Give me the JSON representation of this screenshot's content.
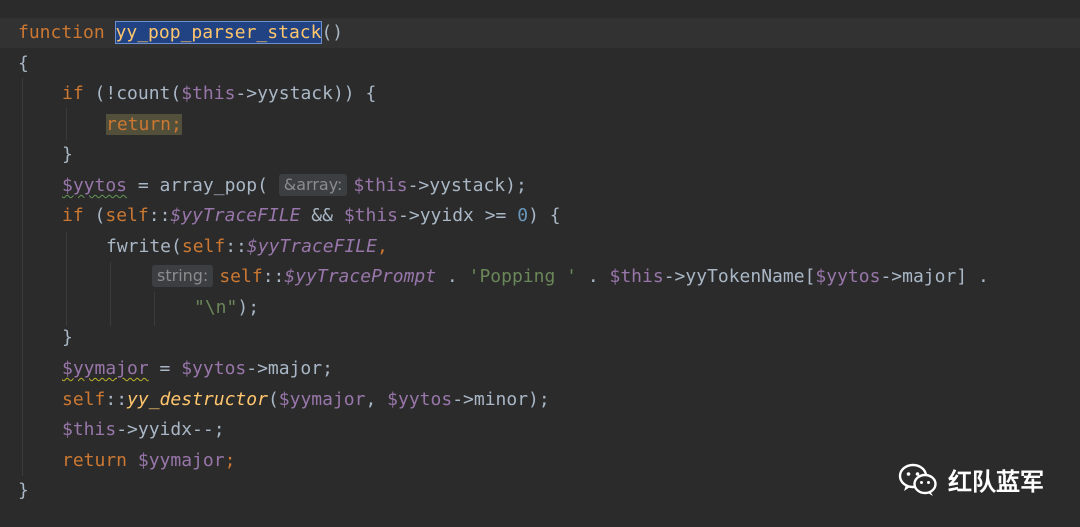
{
  "code": {
    "l1_keyword": "function",
    "l1_name": "yy_pop_parser_stack",
    "l1_tail": "()",
    "l2": "{",
    "l3_if": "if",
    "l3_a": " (!count(",
    "l3_this": "$this",
    "l3_b": "->yystack)) {",
    "l4_return": "return;",
    "l5": "}",
    "l6_var": "$yytos",
    "l6_a": " = array_pop( ",
    "l6_hint": "&array:",
    "l6_this": "$this",
    "l6_b": "->yystack);",
    "l7_if": "if",
    "l7_a": " (",
    "l7_self": "self",
    "l7_colons": "::",
    "l7_static": "$yyTraceFILE",
    "l7_b": " && ",
    "l7_this": "$this",
    "l7_c": "->yyidx >= ",
    "l7_num": "0",
    "l7_d": ") {",
    "l8_fn": "fwrite(",
    "l8_self": "self",
    "l8_colons": "::",
    "l8_static": "$yyTraceFILE",
    "l8_comma": ",",
    "l9_hint": "string:",
    "l9_self": "self",
    "l9_colons": "::",
    "l9_static": "$yyTracePrompt",
    "l9_a": " . ",
    "l9_str": "'Popping '",
    "l9_b": " . ",
    "l9_this": "$this",
    "l9_c": "->yyTokenName[",
    "l9_var": "$yytos",
    "l9_d": "->major] .",
    "l10_str": "\"\\n\"",
    "l10_tail": ");",
    "l11": "}",
    "l12_var": "$yymajor",
    "l12_a": " = ",
    "l12_var2": "$yytos",
    "l12_b": "->major;",
    "l13_self": "self",
    "l13_colons": "::",
    "l13_fn": "yy_destructor",
    "l13_a": "(",
    "l13_var": "$yymajor",
    "l13_b": ", ",
    "l13_var2": "$yytos",
    "l13_c": "->minor);",
    "l14_this": "$this",
    "l14_a": "->yyidx--;",
    "l15_return": "return",
    "l15_sp": " ",
    "l15_var": "$yymajor",
    "l15_semi": ";",
    "l16": "}"
  },
  "watermark": {
    "icon": "wechat-icon",
    "text": "红队蓝军"
  },
  "colors": {
    "background": "#2b2b2b",
    "keyword": "#cc7832",
    "function": "#ffc66d",
    "variable": "#9876aa",
    "string": "#6a8759",
    "number": "#6897bb",
    "text": "#a9b7c6",
    "selection": "#214283"
  }
}
